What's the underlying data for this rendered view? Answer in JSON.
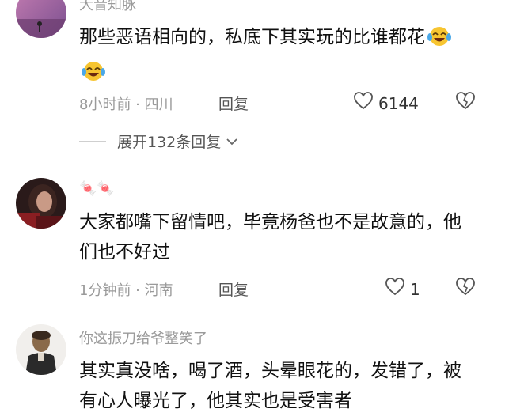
{
  "comments": [
    {
      "username": "大音知脉",
      "text": "那些恶语相向的，私底下其实玩的比谁都花",
      "emoji": [
        "crying-laughing-emoji",
        "crying-laughing-emoji"
      ],
      "meta": "8小时前 · 四川",
      "reply_label": "回复",
      "likes": "6144",
      "expand_label": "展开132条回复"
    },
    {
      "username": "🍬🍬",
      "text": "大家都嘴下留情吧，毕竟杨爸也不是故意的，他们也不好过",
      "meta": "1分钟前 · 河南",
      "reply_label": "回复",
      "likes": "1"
    },
    {
      "username": "你这振刀给爷整笑了",
      "text": "其实真没啥，喝了酒，头晕眼花的，发错了，被有心人曝光了，他其实也是受害者"
    }
  ],
  "colors": {
    "meta_gray": "#9a9a9a",
    "text": "#111111",
    "emoji_yellow": "#f7c531",
    "tear_blue": "#4aa8e8"
  }
}
